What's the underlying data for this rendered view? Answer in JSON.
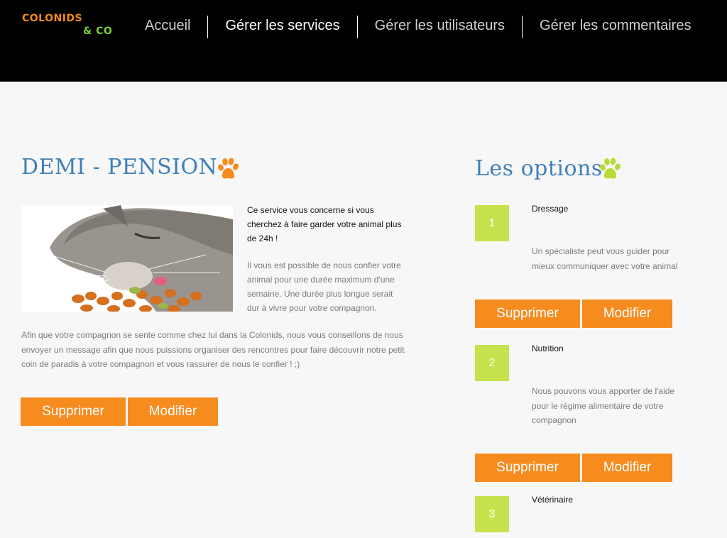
{
  "header": {
    "logo_line1": "COLONIDS",
    "logo_line2": "& CO",
    "nav": [
      {
        "label": "Accueil"
      },
      {
        "label": "Gérer les services"
      },
      {
        "label": "Gérer les utilisateurs"
      },
      {
        "label": "Gérer les commentaires"
      }
    ],
    "active_nav": "Gérer les services"
  },
  "service": {
    "title": "DEMI - PENSION",
    "intro": "Ce service vous concerne si vous cherchez à faire garder votre animal plus de 24h !",
    "details": "Il vous est possible de nous confier votre animal pour une durée maximum d'une semaine. Une durée plus longue serait dur à vivre pour votre compagnon.",
    "long_text": "Afin que votre compagnon se sente comme chez lui dans la Colonids, nous vous conseillons de nous envoyer un message afin que nous puissions organiser des rencontres pour faire découvrir notre petit coin de paradis à votre compagnon et vous rassurer de nous le confier ! ;)",
    "delete_label": "Supprimer",
    "edit_label": "Modifier"
  },
  "options": {
    "title": "Les options",
    "items": [
      {
        "number": "1",
        "name": "Dressage",
        "desc": "Un spécialiste peut vous guider pour mieux communiquer avec votre animal",
        "delete_label": "Supprimer",
        "edit_label": "Modifier"
      },
      {
        "number": "2",
        "name": "Nutrition",
        "desc": "Nous pouvons vous apporter de l'aide pour le régime alimentaire de votre compagnon",
        "delete_label": "Supprimer",
        "edit_label": "Modifier"
      },
      {
        "number": "3",
        "name": "Vétérinaire"
      }
    ]
  },
  "colors": {
    "header_bg": "#000000",
    "accent_orange": "#f68b1e",
    "accent_green": "#c6e24c",
    "title_blue": "#3f7fba",
    "page_bg": "#f7f7f7"
  },
  "icons": [
    "paw-print-icon-orange",
    "paw-print-icon-green"
  ]
}
